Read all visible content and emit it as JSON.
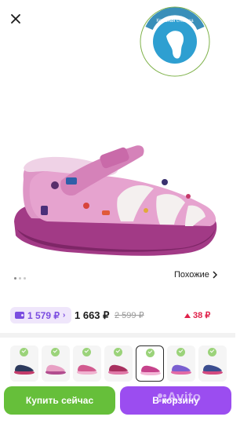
{
  "badge": {
    "arc_text": "Кожаная стелька",
    "left_arc_text": "Антибактериальная",
    "bottom_arc_text": "Анатомическая",
    "right_arc_text": "Благоприятная"
  },
  "gallery": {
    "dots_count": 3,
    "active_dot": 0,
    "similar_label": "Похожие"
  },
  "pricing": {
    "wallet_price": "1 579 ₽",
    "regular_price": "1 663 ₽",
    "old_price": "2 599 ₽",
    "cashback": "38 ₽"
  },
  "variants": [
    {
      "color": "#2d3a5c",
      "accent": "#c33b6a",
      "selected": false
    },
    {
      "color": "#e8a0c4",
      "accent": "#b24d8f",
      "selected": false
    },
    {
      "color": "#d25a8f",
      "accent": "#f0b3d0",
      "selected": false
    },
    {
      "color": "#a8305f",
      "accent": "#e07aa8",
      "selected": false
    },
    {
      "color": "#c6438b",
      "accent": "#f3b6d6",
      "selected": true
    },
    {
      "color": "#7a5fd0",
      "accent": "#e26aa5",
      "selected": false
    },
    {
      "color": "#3b4d8f",
      "accent": "#d34a7f",
      "selected": false
    }
  ],
  "actions": {
    "buy_now": "Купить сейчас",
    "add_to_cart": "В корзину"
  },
  "watermark": "Avito",
  "colors": {
    "buy": "#66bf3a",
    "cart": "#9b4df0",
    "wallet_accent": "#7b4de0",
    "cashback": "#e0214a",
    "shoe_main": "#d98fc0",
    "sole": "#a23a86"
  }
}
